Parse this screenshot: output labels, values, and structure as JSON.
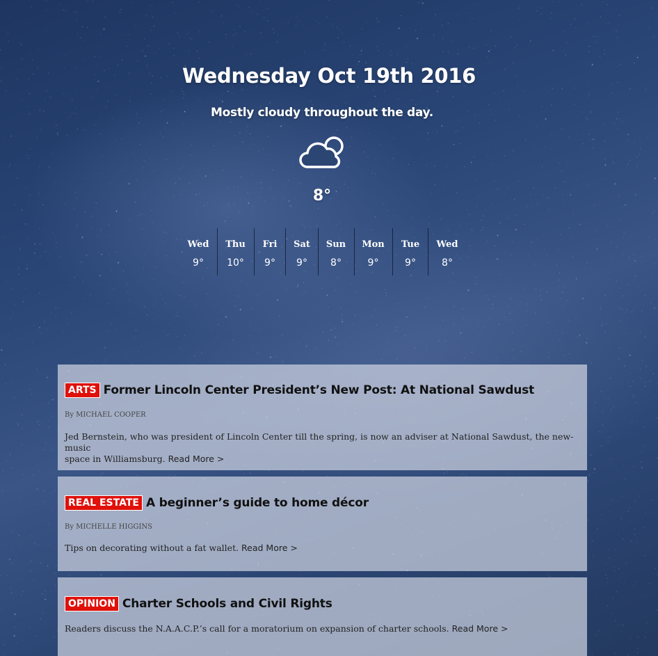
{
  "weather": {
    "date": "Wednesday Oct 19th 2016",
    "summary": "Mostly cloudy throughout the day.",
    "icon": "partly-cloudy-icon",
    "temperature": "8°",
    "forecast": [
      {
        "day": "Wed",
        "temp": "9°"
      },
      {
        "day": "Thu",
        "temp": "10°"
      },
      {
        "day": "Fri",
        "temp": "9°"
      },
      {
        "day": "Sat",
        "temp": "9°"
      },
      {
        "day": "Sun",
        "temp": "8°"
      },
      {
        "day": "Mon",
        "temp": "9°"
      },
      {
        "day": "Tue",
        "temp": "9°"
      },
      {
        "day": "Wed",
        "temp": "8°"
      }
    ]
  },
  "articles": [
    {
      "tag": "ARTS",
      "title": "Former Lincoln Center President’s New Post: At National Sawdust",
      "byline": "By MICHAEL COOPER",
      "description_line1": "Jed Bernstein, who was president of Lincoln Center till the spring, is now an adviser at National Sawdust, the new-music",
      "description_line2": "space in Williamsburg.",
      "read_more": "Read More >"
    },
    {
      "tag": "REAL ESTATE",
      "title": "A beginner’s guide to home décor",
      "byline": "By MICHELLE HIGGINS",
      "description_line1": "Tips on decorating without a fat wallet.",
      "read_more": "Read More >"
    },
    {
      "tag": "OPINION",
      "title": "Charter Schools and Civil Rights",
      "description_line1": "Readers discuss the N.A.A.C.P.’s call for a moratorium on expansion of charter schools.",
      "read_more": "Read More >"
    }
  ],
  "colors": {
    "tag_background": "#e0100a",
    "card_background": "rgba(205,210,225,0.72)",
    "sky": "#2a4778"
  }
}
